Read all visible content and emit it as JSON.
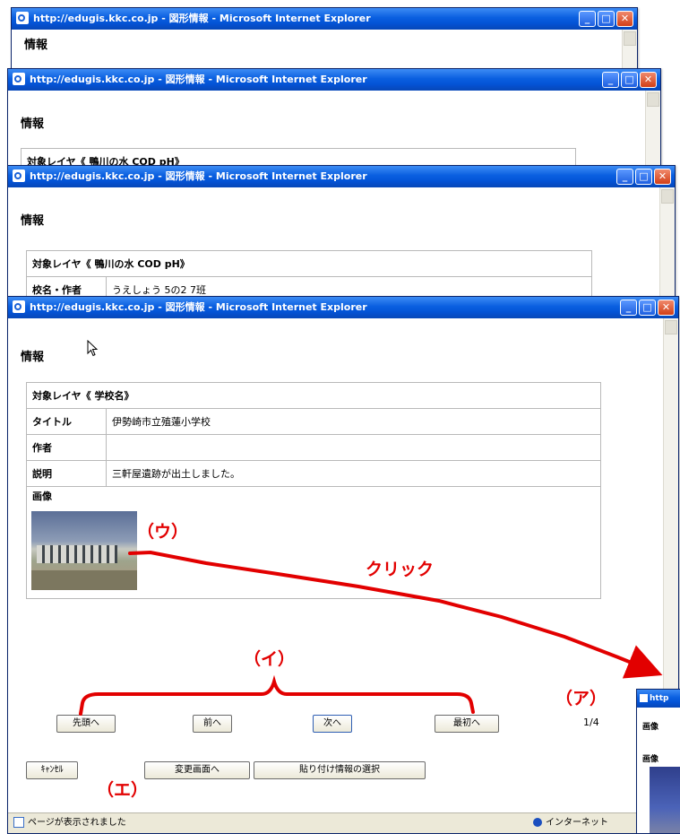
{
  "window_title": "http://edugis.kkc.co.jp - 図形情報 - Microsoft Internet Explorer",
  "window_title_truncated": "http://edugis.kkc.co.jp - 図形情報 - Microsoft Internet Explorer",
  "title_buttons": {
    "minimize": "_",
    "maximize": "□",
    "close": "✕"
  },
  "heading": "情報",
  "layer_header_pages": [
    "対象レイヤ《 鴨川の水 COD pH》",
    "対象レイヤ《 鴨川の水 COD pH》"
  ],
  "page3_row": {
    "key": "校名・作者",
    "value": "うえしょう 5の2 7班"
  },
  "main": {
    "layer_header": "対象レイヤ《 学校名》",
    "rows": [
      {
        "key": "タイトル",
        "value": "伊勢崎市立殖蓮小学校"
      },
      {
        "key": "作者",
        "value": ""
      },
      {
        "key": "説明",
        "value": "三軒屋遺跡が出土しました。"
      }
    ],
    "image_label": "画像",
    "nav_buttons": [
      "先頭へ",
      "前へ",
      "次へ",
      "最初へ"
    ],
    "page_indicator": "1/4",
    "cancel": "ｷｬﾝｾﾙ",
    "change_screen": "変更画面へ",
    "paste_select": "貼り付け情報の選択",
    "status_text": "ページが表示されました",
    "zone": "インターネット"
  },
  "annotations": {
    "a": "（ア）",
    "i": "（イ）",
    "u": "（ウ）",
    "e": "（エ）",
    "click": "クリック"
  },
  "popup": {
    "title": "http",
    "label1": "画像",
    "label2": "画像"
  },
  "colors": {
    "annotation": "#e20000",
    "titlebar": "#0453d6"
  }
}
